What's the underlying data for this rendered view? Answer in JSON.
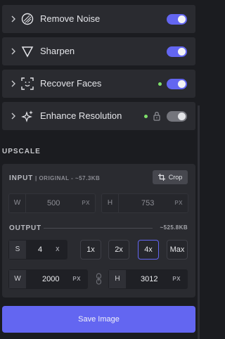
{
  "features": [
    {
      "label": "Remove Noise",
      "icon": "noise-circle-icon",
      "enabled": true,
      "indicator": false,
      "locked": false
    },
    {
      "label": "Sharpen",
      "icon": "sharpen-triangle-icon",
      "enabled": true,
      "indicator": false,
      "locked": false
    },
    {
      "label": "Recover Faces",
      "icon": "face-scan-icon",
      "enabled": true,
      "indicator": true,
      "locked": false
    },
    {
      "label": "Enhance Resolution",
      "icon": "sparkle-icon",
      "enabled": false,
      "indicator": true,
      "locked": true
    }
  ],
  "upscale": {
    "section_title": "UPSCALE",
    "input": {
      "title": "INPUT",
      "subtitle": "| ORIGINAL - ~57.3KB",
      "crop_label": "Crop",
      "width_label": "W",
      "width_value": "500",
      "width_unit": "PX",
      "height_label": "H",
      "height_value": "753",
      "height_unit": "PX"
    },
    "output": {
      "title": "OUTPUT",
      "size": "~525.8KB",
      "scale_label": "S",
      "scale_value": "4",
      "scale_unit": "X",
      "presets": [
        "1x",
        "2x",
        "4x",
        "Max"
      ],
      "selected_preset": "4x",
      "width_label": "W",
      "width_value": "2000",
      "width_unit": "PX",
      "height_label": "H",
      "height_value": "3012",
      "height_unit": "PX"
    }
  },
  "save_label": "Save Image",
  "colors": {
    "accent": "#6366f1",
    "indicator": "#7ee06a",
    "panel": "#2a2b30",
    "background": "#1b1c20"
  }
}
